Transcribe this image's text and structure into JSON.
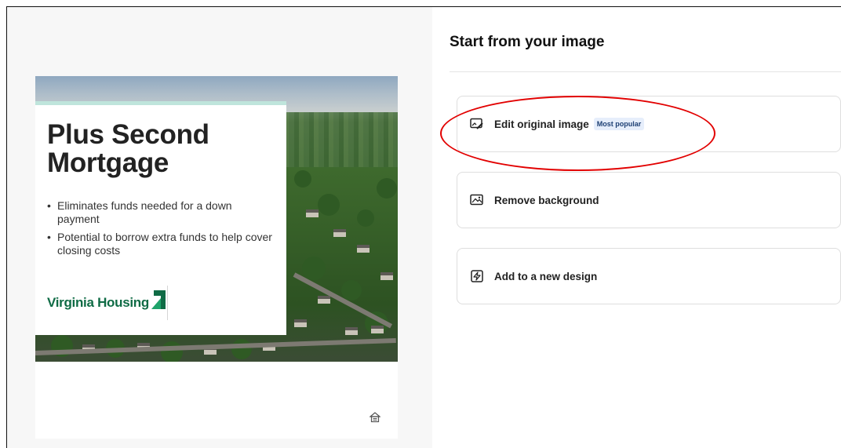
{
  "preview": {
    "headline": "Plus Second Mortgage",
    "bullets": [
      "Eliminates funds needed for a down payment",
      "Potential to borrow extra funds to help cover closing costs"
    ],
    "brand_name": "Virginia Housing",
    "brand_color": "#0f6b45",
    "accent_band_color": "#bfe5dc",
    "footer_icon": "equal-housing-icon"
  },
  "panel": {
    "title": "Start from your image",
    "options": [
      {
        "label": "Edit original image",
        "badge": "Most popular",
        "icon": "edit-image-icon"
      },
      {
        "label": "Remove background",
        "icon": "remove-background-icon"
      },
      {
        "label": "Add to a new design",
        "icon": "new-design-icon"
      }
    ]
  },
  "annotation": {
    "highlight_color": "#e20000"
  }
}
